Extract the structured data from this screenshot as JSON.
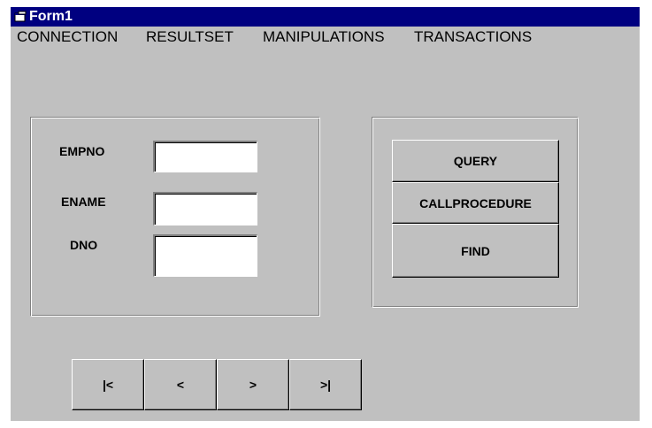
{
  "window": {
    "title": "Form1"
  },
  "menu": [
    {
      "label": "CONNECTION"
    },
    {
      "label": "RESULTSET"
    },
    {
      "label": "MANIPULATIONS"
    },
    {
      "label": "TRANSACTIONS"
    }
  ],
  "fields": {
    "empno": {
      "label": "EMPNO",
      "value": ""
    },
    "ename": {
      "label": "ENAME",
      "value": ""
    },
    "dno": {
      "label": "DNO",
      "value": ""
    }
  },
  "actions": {
    "query": "QUERY",
    "callprocedure": "CALLPROCEDURE",
    "find": "FIND"
  },
  "navigation": {
    "first": "|<",
    "prev": "<",
    "next": ">",
    "last": ">|"
  },
  "colors": {
    "titlebar": "#000080",
    "face": "#c0c0c0"
  }
}
